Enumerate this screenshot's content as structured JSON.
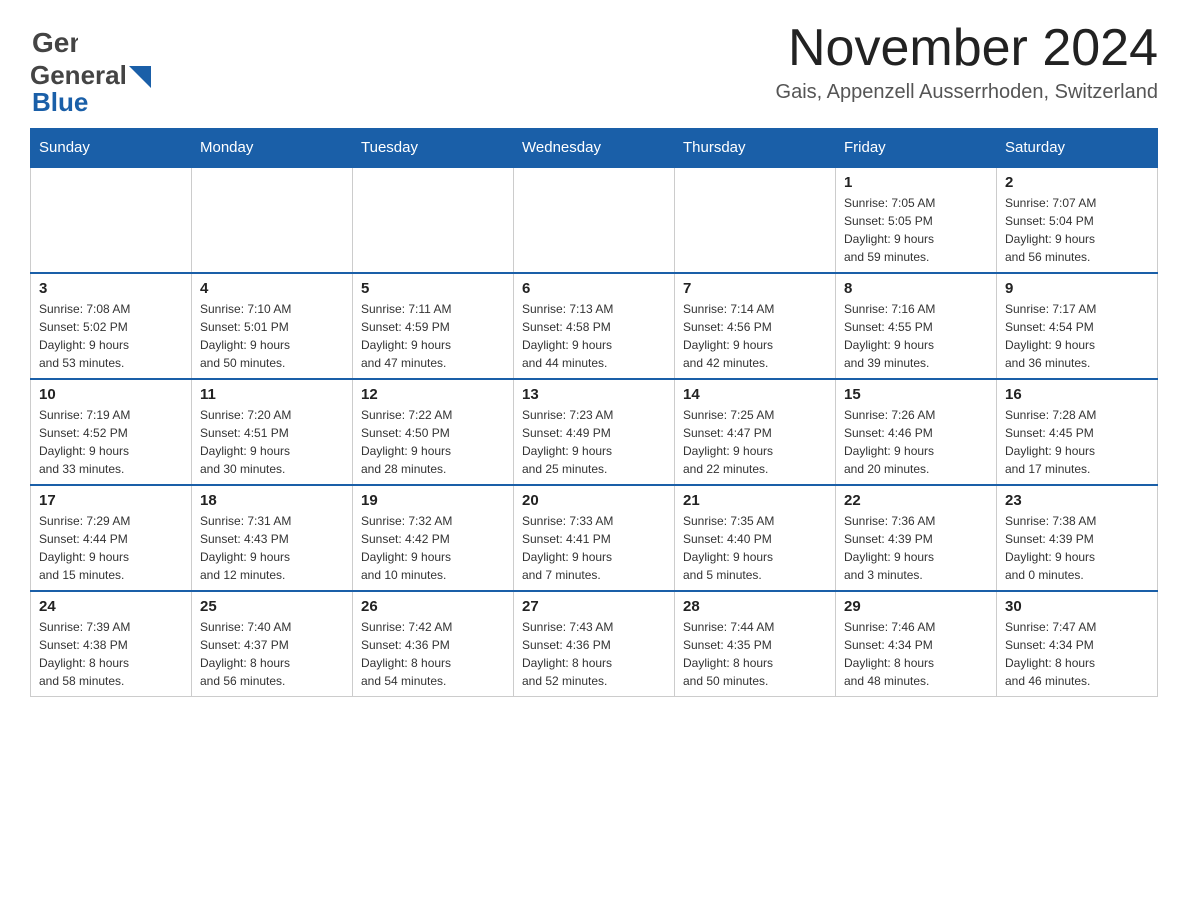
{
  "logo": {
    "name_general": "General",
    "name_blue": "Blue"
  },
  "title": {
    "month_year": "November 2024",
    "location": "Gais, Appenzell Ausserrhoden, Switzerland"
  },
  "headers": [
    "Sunday",
    "Monday",
    "Tuesday",
    "Wednesday",
    "Thursday",
    "Friday",
    "Saturday"
  ],
  "weeks": [
    {
      "days": [
        {
          "number": "",
          "info": ""
        },
        {
          "number": "",
          "info": ""
        },
        {
          "number": "",
          "info": ""
        },
        {
          "number": "",
          "info": ""
        },
        {
          "number": "",
          "info": ""
        },
        {
          "number": "1",
          "info": "Sunrise: 7:05 AM\nSunset: 5:05 PM\nDaylight: 9 hours\nand 59 minutes."
        },
        {
          "number": "2",
          "info": "Sunrise: 7:07 AM\nSunset: 5:04 PM\nDaylight: 9 hours\nand 56 minutes."
        }
      ]
    },
    {
      "days": [
        {
          "number": "3",
          "info": "Sunrise: 7:08 AM\nSunset: 5:02 PM\nDaylight: 9 hours\nand 53 minutes."
        },
        {
          "number": "4",
          "info": "Sunrise: 7:10 AM\nSunset: 5:01 PM\nDaylight: 9 hours\nand 50 minutes."
        },
        {
          "number": "5",
          "info": "Sunrise: 7:11 AM\nSunset: 4:59 PM\nDaylight: 9 hours\nand 47 minutes."
        },
        {
          "number": "6",
          "info": "Sunrise: 7:13 AM\nSunset: 4:58 PM\nDaylight: 9 hours\nand 44 minutes."
        },
        {
          "number": "7",
          "info": "Sunrise: 7:14 AM\nSunset: 4:56 PM\nDaylight: 9 hours\nand 42 minutes."
        },
        {
          "number": "8",
          "info": "Sunrise: 7:16 AM\nSunset: 4:55 PM\nDaylight: 9 hours\nand 39 minutes."
        },
        {
          "number": "9",
          "info": "Sunrise: 7:17 AM\nSunset: 4:54 PM\nDaylight: 9 hours\nand 36 minutes."
        }
      ]
    },
    {
      "days": [
        {
          "number": "10",
          "info": "Sunrise: 7:19 AM\nSunset: 4:52 PM\nDaylight: 9 hours\nand 33 minutes."
        },
        {
          "number": "11",
          "info": "Sunrise: 7:20 AM\nSunset: 4:51 PM\nDaylight: 9 hours\nand 30 minutes."
        },
        {
          "number": "12",
          "info": "Sunrise: 7:22 AM\nSunset: 4:50 PM\nDaylight: 9 hours\nand 28 minutes."
        },
        {
          "number": "13",
          "info": "Sunrise: 7:23 AM\nSunset: 4:49 PM\nDaylight: 9 hours\nand 25 minutes."
        },
        {
          "number": "14",
          "info": "Sunrise: 7:25 AM\nSunset: 4:47 PM\nDaylight: 9 hours\nand 22 minutes."
        },
        {
          "number": "15",
          "info": "Sunrise: 7:26 AM\nSunset: 4:46 PM\nDaylight: 9 hours\nand 20 minutes."
        },
        {
          "number": "16",
          "info": "Sunrise: 7:28 AM\nSunset: 4:45 PM\nDaylight: 9 hours\nand 17 minutes."
        }
      ]
    },
    {
      "days": [
        {
          "number": "17",
          "info": "Sunrise: 7:29 AM\nSunset: 4:44 PM\nDaylight: 9 hours\nand 15 minutes."
        },
        {
          "number": "18",
          "info": "Sunrise: 7:31 AM\nSunset: 4:43 PM\nDaylight: 9 hours\nand 12 minutes."
        },
        {
          "number": "19",
          "info": "Sunrise: 7:32 AM\nSunset: 4:42 PM\nDaylight: 9 hours\nand 10 minutes."
        },
        {
          "number": "20",
          "info": "Sunrise: 7:33 AM\nSunset: 4:41 PM\nDaylight: 9 hours\nand 7 minutes."
        },
        {
          "number": "21",
          "info": "Sunrise: 7:35 AM\nSunset: 4:40 PM\nDaylight: 9 hours\nand 5 minutes."
        },
        {
          "number": "22",
          "info": "Sunrise: 7:36 AM\nSunset: 4:39 PM\nDaylight: 9 hours\nand 3 minutes."
        },
        {
          "number": "23",
          "info": "Sunrise: 7:38 AM\nSunset: 4:39 PM\nDaylight: 9 hours\nand 0 minutes."
        }
      ]
    },
    {
      "days": [
        {
          "number": "24",
          "info": "Sunrise: 7:39 AM\nSunset: 4:38 PM\nDaylight: 8 hours\nand 58 minutes."
        },
        {
          "number": "25",
          "info": "Sunrise: 7:40 AM\nSunset: 4:37 PM\nDaylight: 8 hours\nand 56 minutes."
        },
        {
          "number": "26",
          "info": "Sunrise: 7:42 AM\nSunset: 4:36 PM\nDaylight: 8 hours\nand 54 minutes."
        },
        {
          "number": "27",
          "info": "Sunrise: 7:43 AM\nSunset: 4:36 PM\nDaylight: 8 hours\nand 52 minutes."
        },
        {
          "number": "28",
          "info": "Sunrise: 7:44 AM\nSunset: 4:35 PM\nDaylight: 8 hours\nand 50 minutes."
        },
        {
          "number": "29",
          "info": "Sunrise: 7:46 AM\nSunset: 4:34 PM\nDaylight: 8 hours\nand 48 minutes."
        },
        {
          "number": "30",
          "info": "Sunrise: 7:47 AM\nSunset: 4:34 PM\nDaylight: 8 hours\nand 46 minutes."
        }
      ]
    }
  ]
}
